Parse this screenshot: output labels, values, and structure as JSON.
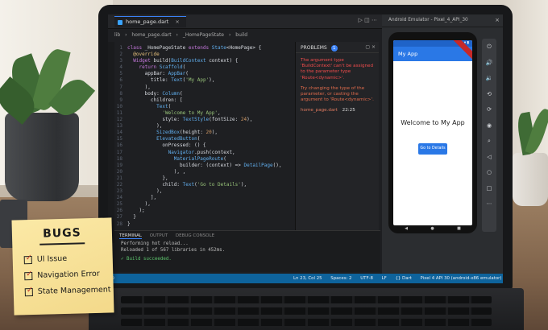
{
  "editor": {
    "tab_label": "home_page.dart",
    "tab_close": "×",
    "breadcrumb": [
      "lib",
      "home_page.dart",
      "_HomePageState",
      "build"
    ],
    "code_lines": [
      {
        "n": "1",
        "t": "class _HomePageState extends State<HomePage> {"
      },
      {
        "n": "2",
        "t": "  @override"
      },
      {
        "n": "3",
        "t": "  Widget build(BuildContext context) {"
      },
      {
        "n": "4",
        "t": "    return Scaffold("
      },
      {
        "n": "5",
        "t": "      appBar: AppBar("
      },
      {
        "n": "6",
        "t": "        title: Text('My App'),"
      },
      {
        "n": "7",
        "t": "      ),"
      },
      {
        "n": "8",
        "t": "      body: Column("
      },
      {
        "n": "9",
        "t": "        children: ["
      },
      {
        "n": "10",
        "t": "          Text("
      },
      {
        "n": "11",
        "t": "            'Welcome to My App',"
      },
      {
        "n": "12",
        "t": "            style: TextStyle(fontSize: 24),"
      },
      {
        "n": "13",
        "t": "          ),"
      },
      {
        "n": "14",
        "t": "          SizedBox(height: 20),"
      },
      {
        "n": "15",
        "t": "          ElevatedButton("
      },
      {
        "n": "16",
        "t": "            onPressed: () {"
      },
      {
        "n": "17",
        "t": "              Navigator.push(context,"
      },
      {
        "n": "18",
        "t": "                MaterialPageRoute("
      },
      {
        "n": "19",
        "t": "                  builder: (context) => DetailPage(),"
      },
      {
        "n": "20",
        "t": "                ), ,"
      },
      {
        "n": "21",
        "t": "            },"
      },
      {
        "n": "22",
        "t": "            child: Text('Go to Details'),"
      },
      {
        "n": "23",
        "t": "          ),"
      },
      {
        "n": "24",
        "t": "        ],"
      },
      {
        "n": "25",
        "t": "      ),"
      },
      {
        "n": "26",
        "t": "    );"
      },
      {
        "n": "27",
        "t": "  }"
      },
      {
        "n": "28",
        "t": "}"
      }
    ]
  },
  "problems": {
    "title": "PROBLEMS",
    "count": "1",
    "message_1": "The argument type 'BuildContext' can't be assigned to the parameter type 'Route<dynamic>'.",
    "message_2": "Try changing the type of the parameter, or casting the argument to 'Route<dynamic>'.",
    "file": "home_page.dart",
    "location": "22:25"
  },
  "terminal": {
    "tabs": [
      "TERMINAL",
      "OUTPUT",
      "DEBUG CONSOLE"
    ],
    "lines": [
      "Performing hot reload...",
      "Reloaded 1 of 567 libraries in 452ms."
    ],
    "success": "✓ Build succeeded."
  },
  "statusbar": {
    "items": [
      "Ln 23, Col 25",
      "Spaces: 2",
      "UTF-8",
      "LF",
      "{} Dart",
      "Pixel 4 API 30 (android-x86 emulator)"
    ]
  },
  "emulator": {
    "title": "Android Emulator - Pixel_4_API_30",
    "close": "×",
    "app_title": "My App",
    "welcome_text": "Welcome to My App",
    "button_label": "Go to Details",
    "side_icons": [
      "power-icon",
      "volume-up-icon",
      "volume-down-icon",
      "rotate-icon",
      "camera-icon",
      "location-icon",
      "back-icon",
      "home-icon",
      "overview-icon",
      "more-icon"
    ]
  },
  "sticky": {
    "title": "BUGS",
    "items": [
      "UI Issue",
      "Navigation Error",
      "State Management"
    ]
  }
}
